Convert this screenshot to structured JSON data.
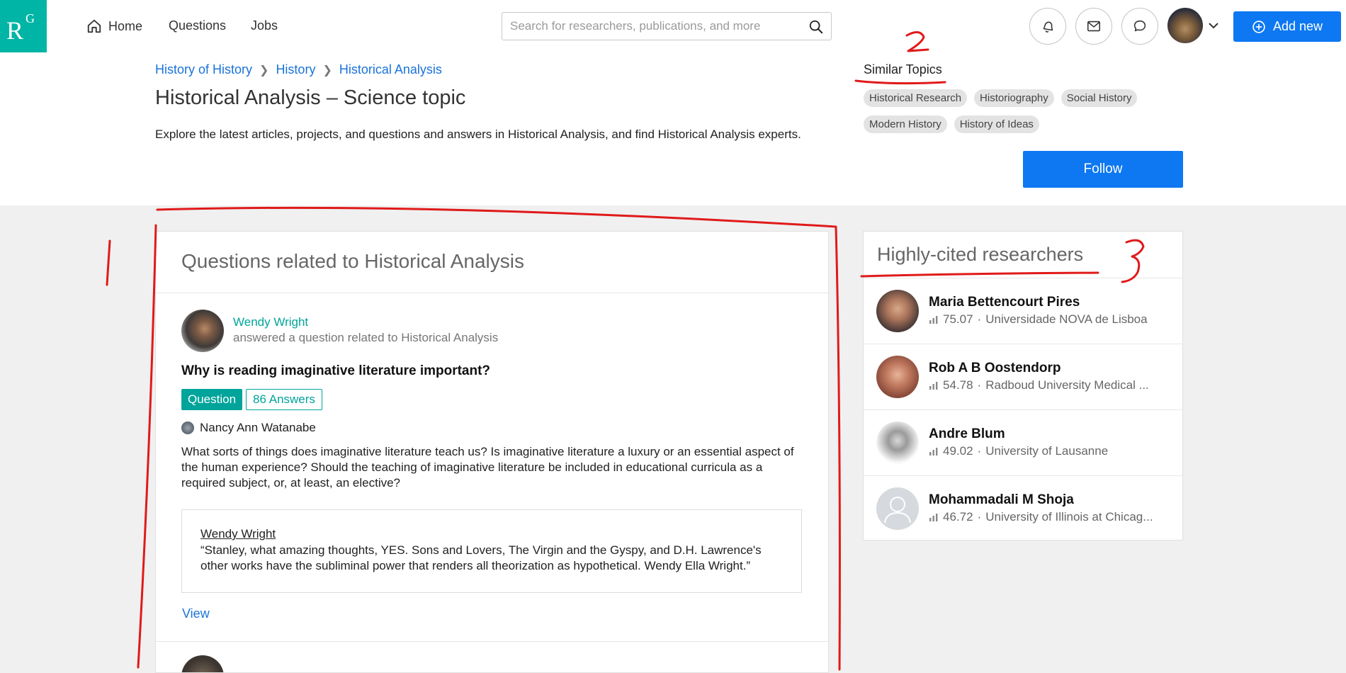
{
  "app": {
    "logo_main": "R",
    "logo_sup": "G"
  },
  "nav": {
    "home": "Home",
    "questions": "Questions",
    "jobs": "Jobs"
  },
  "search": {
    "placeholder": "Search for researchers, publications, and more"
  },
  "toolbar": {
    "add_new": "Add new"
  },
  "breadcrumb": [
    "History of History",
    "History",
    "Historical Analysis"
  ],
  "page": {
    "title": "Historical Analysis – Science topic",
    "description": "Explore the latest articles, projects, and questions and answers in Historical Analysis, and find Historical Analysis experts."
  },
  "similar_topics": {
    "label": "Similar Topics",
    "topics": [
      "Historical Research",
      "Historiography",
      "Social History",
      "Modern History",
      "History of Ideas"
    ],
    "follow": "Follow"
  },
  "questions": {
    "heading": "Questions related to Historical Analysis",
    "item": {
      "user": "Wendy Wright",
      "action": "answered a question related to Historical Analysis",
      "title": "Why is reading imaginative literature important?",
      "badge_question": "Question",
      "badge_answers": "86 Answers",
      "asker": "Nancy Ann Watanabe",
      "body": "What sorts of things does imaginative literature teach us? Is imaginative literature a luxury or an essential aspect of the human experience? Should the teaching of imaginative literature be included in educational curricula as a required subject, or, at least, an elective?",
      "answer_author": "Wendy Wright",
      "answer_text": "“Stanley, what amazing thoughts, YES. Sons and Lovers, The Virgin and the Gyspy, and D.H. Lawrence's other works have the subliminal power that renders all theorization as hypothetical. Wendy Ella Wright.”",
      "view": "View"
    }
  },
  "researchers": {
    "heading": "Highly-cited researchers",
    "items": [
      {
        "name": "Maria Bettencourt Pires",
        "score": "75.07",
        "institution": "Universidade NOVA de Lisboa"
      },
      {
        "name": "Rob A B Oostendorp",
        "score": "54.78",
        "institution": "Radboud University Medical ..."
      },
      {
        "name": "Andre Blum",
        "score": "49.02",
        "institution": "University of Lausanne"
      },
      {
        "name": "Mohammadali M Shoja",
        "score": "46.72",
        "institution": "University of Illinois at Chicag..."
      }
    ]
  },
  "annotations": {
    "label_1": "1",
    "label_2": "2",
    "label_3": "3",
    "color": "#e01a1a"
  },
  "colors": {
    "brand": "#00b5a5",
    "primary": "#0d78f2",
    "teal": "#00a49a",
    "link": "#1a73d9"
  }
}
